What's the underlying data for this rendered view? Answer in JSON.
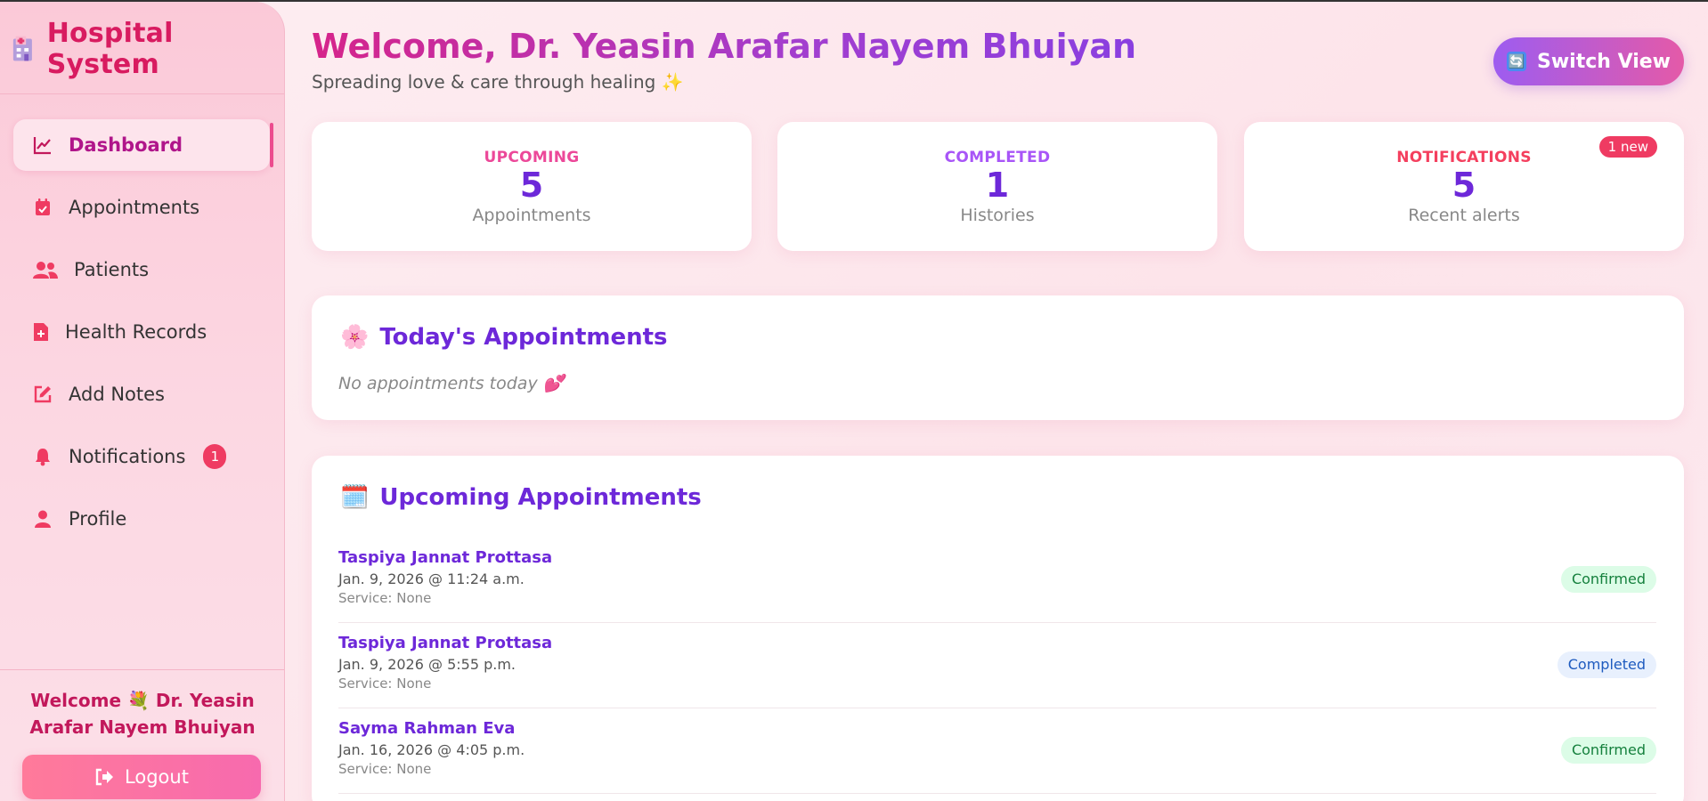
{
  "brand": {
    "title": "Hospital System"
  },
  "sidebar": {
    "items": [
      {
        "label": "Dashboard",
        "icon": "chart-line-icon",
        "active": true
      },
      {
        "label": "Appointments",
        "icon": "calendar-check-icon"
      },
      {
        "label": "Patients",
        "icon": "users-icon"
      },
      {
        "label": "Health Records",
        "icon": "file-medical-icon"
      },
      {
        "label": "Add Notes",
        "icon": "edit-icon"
      },
      {
        "label": "Notifications",
        "icon": "bell-icon",
        "badge": "1"
      },
      {
        "label": "Profile",
        "icon": "user-icon"
      }
    ],
    "welcome": "Welcome 💐 Dr. Yeasin Arafar Nayem Bhuiyan",
    "logout_label": "Logout"
  },
  "header": {
    "title": "Welcome, Dr. Yeasin Arafar Nayem Bhuiyan",
    "subtitle": "Spreading love & care through healing ✨",
    "switch_label": "Switch View",
    "switch_icon": "🔄"
  },
  "stats": [
    {
      "label": "UPCOMING",
      "value": "5",
      "sub": "Appointments",
      "color": "#ec4899"
    },
    {
      "label": "COMPLETED",
      "value": "1",
      "sub": "Histories",
      "color": "#a855f7"
    },
    {
      "label": "NOTIFICATIONS",
      "value": "5",
      "sub": "Recent alerts",
      "color": "#f43f5e",
      "badge": "1 new"
    }
  ],
  "today": {
    "title": "Today's Appointments",
    "icon": "🌸",
    "empty_text": "No appointments today 💕"
  },
  "upcoming": {
    "title": "Upcoming Appointments",
    "icon": "🗓️",
    "items": [
      {
        "name": "Taspiya Jannat Prottasa",
        "when": "Jan. 9, 2026 @ 11:24 a.m.",
        "service": "Service: None",
        "status": "Confirmed"
      },
      {
        "name": "Taspiya Jannat Prottasa",
        "when": "Jan. 9, 2026 @ 5:55 p.m.",
        "service": "Service: None",
        "status": "Completed"
      },
      {
        "name": "Sayma Rahman Eva",
        "when": "Jan. 16, 2026 @ 4:05 p.m.",
        "service": "Service: None",
        "status": "Confirmed"
      }
    ]
  },
  "colors": {
    "brand": "#d81b60",
    "accent": "#6d28d9",
    "badge": "#ef3b62"
  }
}
